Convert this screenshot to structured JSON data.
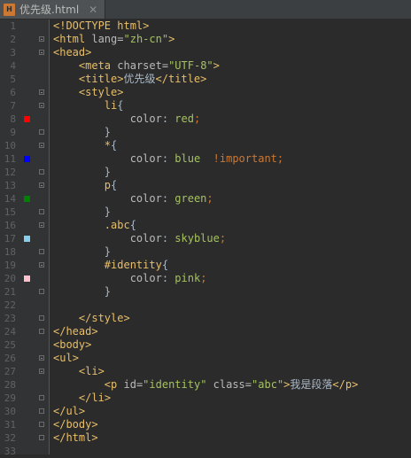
{
  "tab": {
    "filename": "优先级.html",
    "icon": "html-file-icon"
  },
  "gutter": {
    "line_numbers": [
      "1",
      "2",
      "3",
      "4",
      "5",
      "6",
      "7",
      "8",
      "9",
      "10",
      "11",
      "12",
      "13",
      "14",
      "15",
      "16",
      "17",
      "18",
      "19",
      "20",
      "21",
      "22",
      "23",
      "24",
      "25",
      "26",
      "27",
      "28",
      "29",
      "30",
      "31",
      "32",
      "33"
    ],
    "swatches": [
      {
        "line": 8,
        "color": "#ff0000"
      },
      {
        "line": 11,
        "color": "#0000ff"
      },
      {
        "line": 14,
        "color": "#008000"
      },
      {
        "line": 17,
        "color": "#87ceeb"
      },
      {
        "line": 20,
        "color": "#ffc0cb"
      }
    ]
  },
  "code": [
    "<!DOCTYPE html>",
    "<html lang=\"zh-cn\">",
    "<head>",
    "    <meta charset=\"UTF-8\">",
    "    <title>优先级</title>",
    "    <style>",
    "        li{",
    "            color: red;",
    "        }",
    "        *{",
    "            color: blue  !important;",
    "        }",
    "        p{",
    "            color: green;",
    "        }",
    "        .abc{",
    "            color: skyblue;",
    "        }",
    "        #identity{",
    "            color: pink;",
    "        }",
    "",
    "    </style>",
    "</head>",
    "<body>",
    "<ul>",
    "    <li>",
    "        <p id=\"identity\" class=\"abc\">我是段落</p>",
    "    </li>",
    "</ul>",
    "</body>",
    "</html>",
    ""
  ]
}
